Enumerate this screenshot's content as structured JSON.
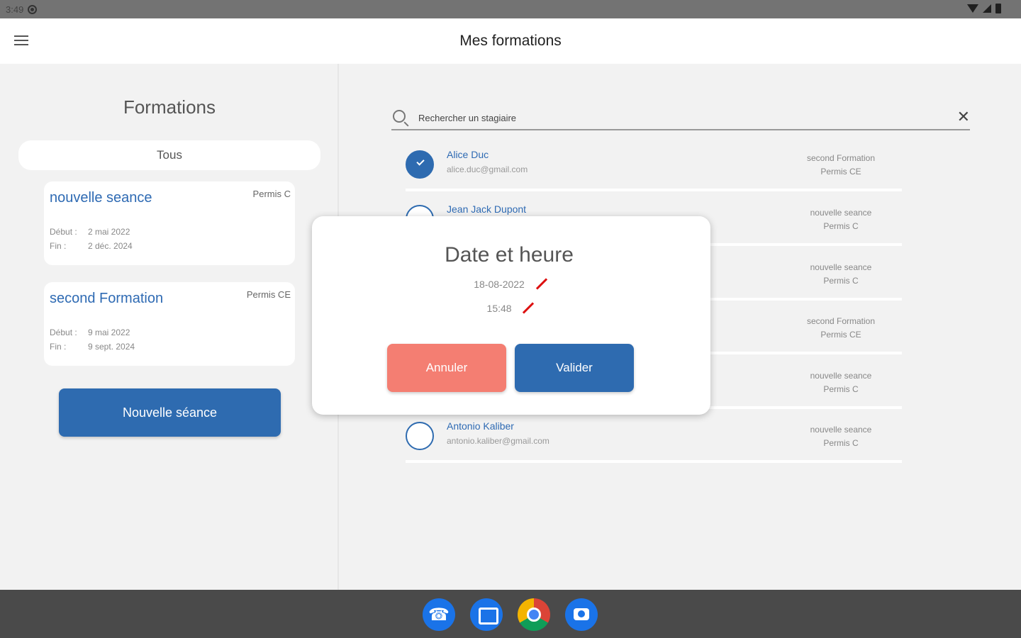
{
  "status_bar": {
    "time": "3:49"
  },
  "app_bar": {
    "title": "Mes formations"
  },
  "left_pane": {
    "title": "Formations",
    "filter_label": "Tous",
    "cards": [
      {
        "title": "nouvelle seance",
        "type": "Permis C",
        "start_label": "Début :",
        "start": "2 mai 2022",
        "end_label": "Fin :",
        "end": "2 déc. 2024"
      },
      {
        "title": "second Formation",
        "type": "Permis CE",
        "start_label": "Début :",
        "start": "9 mai 2022",
        "end_label": "Fin :",
        "end": "9 sept. 2024"
      }
    ],
    "new_session_button": "Nouvelle séance"
  },
  "search": {
    "placeholder": "Rechercher un stagiaire",
    "value": ""
  },
  "trainees": [
    {
      "name": "Alice Duc",
      "email": "alice.duc@gmail.com",
      "course": "second Formation",
      "license": "Permis CE",
      "checked": true
    },
    {
      "name": "Jean Jack Dupont",
      "email": "",
      "course": "nouvelle seance",
      "license": "Permis C",
      "checked": false
    },
    {
      "name": "",
      "email": "",
      "course": "nouvelle seance",
      "license": "Permis C",
      "checked": false
    },
    {
      "name": "",
      "email": "",
      "course": "second Formation",
      "license": "Permis CE",
      "checked": false
    },
    {
      "name": "",
      "email": "",
      "course": "nouvelle seance",
      "license": "Permis C",
      "checked": false
    },
    {
      "name": "Antonio Kaliber",
      "email": "antonio.kaliber@gmail.com",
      "course": "nouvelle seance",
      "license": "Permis C",
      "checked": false
    }
  ],
  "dialog": {
    "title": "Date et heure",
    "date": "18-08-2022",
    "time": "15:48",
    "cancel_label": "Annuler",
    "confirm_label": "Valider"
  },
  "dock": {
    "icons": [
      "phone-icon",
      "messages-icon",
      "chrome-icon",
      "camera-icon"
    ]
  },
  "colors": {
    "primary": "#2e6bb0",
    "cancel": "#f47e72",
    "edit": "#dd1111"
  }
}
